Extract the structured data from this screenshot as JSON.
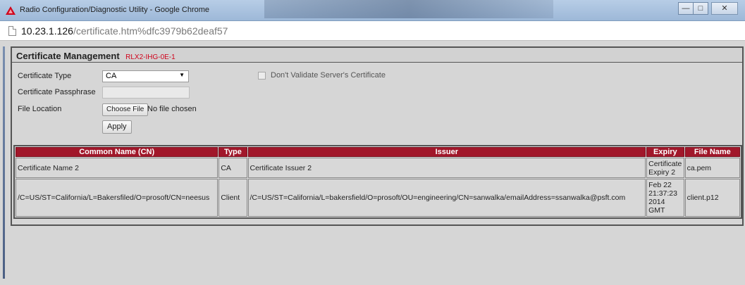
{
  "browser": {
    "window_title": "Radio Configuration/Diagnostic Utility - Google Chrome",
    "url_host": "10.23.1.126",
    "url_path": "/certificate.htm%dfc3979b62deaf57",
    "minimize_label": "—",
    "maximize_label": "□",
    "close_label": "✕"
  },
  "header": {
    "title": "Certificate Management",
    "device": "RLX2-IHG-0E-1"
  },
  "form": {
    "cert_type_label": "Certificate Type",
    "cert_type_value": "CA",
    "passphrase_label": "Certificate Passphrase",
    "passphrase_value": "",
    "file_location_label": "File Location",
    "choose_file_label": "Choose File",
    "file_status": "No file chosen",
    "apply_label": "Apply",
    "dont_validate_label": "Don't Validate Server's Certificate",
    "dont_validate_checked": false
  },
  "table": {
    "columns": [
      "Common Name (CN)",
      "Type",
      "Issuer",
      "Expiry",
      "File Name"
    ],
    "rows": [
      {
        "cn": "Certificate Name 2",
        "type": "CA",
        "issuer": "Certificate Issuer 2",
        "expiry": "Certificate Expiry 2",
        "file": "ca.pem"
      },
      {
        "cn": "/C=US/ST=California/L=Bakersfiled/O=prosoft/CN=neesus",
        "type": "Client",
        "issuer": "/C=US/ST=California/L=bakersfield/O=prosoft/OU=engineering/CN=sanwalka/emailAddress=ssanwalka@psft.com",
        "expiry": "Feb 22 21:37:23 2014 GMT",
        "file": "client.p12"
      }
    ]
  },
  "colors": {
    "table_header_bg": "#a1172a",
    "device_label": "#d0021b"
  }
}
